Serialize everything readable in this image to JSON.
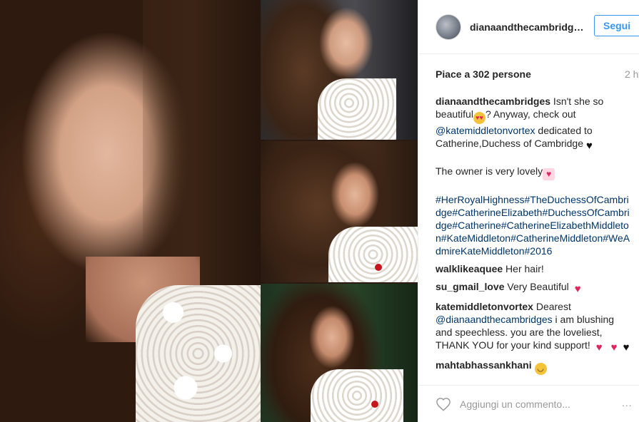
{
  "post": {
    "username": "dianaandthecambridges",
    "follow_label": "Segui",
    "likes": "Piace a 302 persone",
    "time": "2 h",
    "watermark": "dianaandthecambridges"
  },
  "caption": {
    "author": "dianaandthecambridges",
    "text_1": " Isn't she so beautiful",
    "text_2": "? Anyway, check out ",
    "mention": "@katemiddletonvortex",
    "text_3": " dedicated to Catherine,Duchess of Cambridge",
    "line_2": "The owner is very lovely",
    "hashtags": "#HerRoyalHighness#TheDuchessOfCambridge#CatherineElizabeth#DuchessOfCambridge#Catherine#CatherineElizabethMiddleton#KateMiddleton#CatherineMiddleton#WeAdmireKateMiddleton#2016"
  },
  "comments": [
    {
      "user": "walklikeaquee",
      "text": " Her hair!"
    },
    {
      "user": "su_gmail_love",
      "text": " Very Beautiful "
    },
    {
      "user": "katemiddletonvortex",
      "text": " Dearest ",
      "mention": "@dianaandthecambridges",
      "text_2": " i am blushing and speechless. you are the loveliest, THANK YOU for your kind support! "
    },
    {
      "user": "mahtabhassankhani",
      "text": " "
    }
  ],
  "footer": {
    "comment_placeholder": "Aggiungi un commento...",
    "more_label": "..."
  },
  "icons": {
    "like": "heart-outline-icon",
    "more": "more-options-icon"
  },
  "colors": {
    "link": "#003569",
    "follow": "#3897f0",
    "muted": "#999999"
  }
}
